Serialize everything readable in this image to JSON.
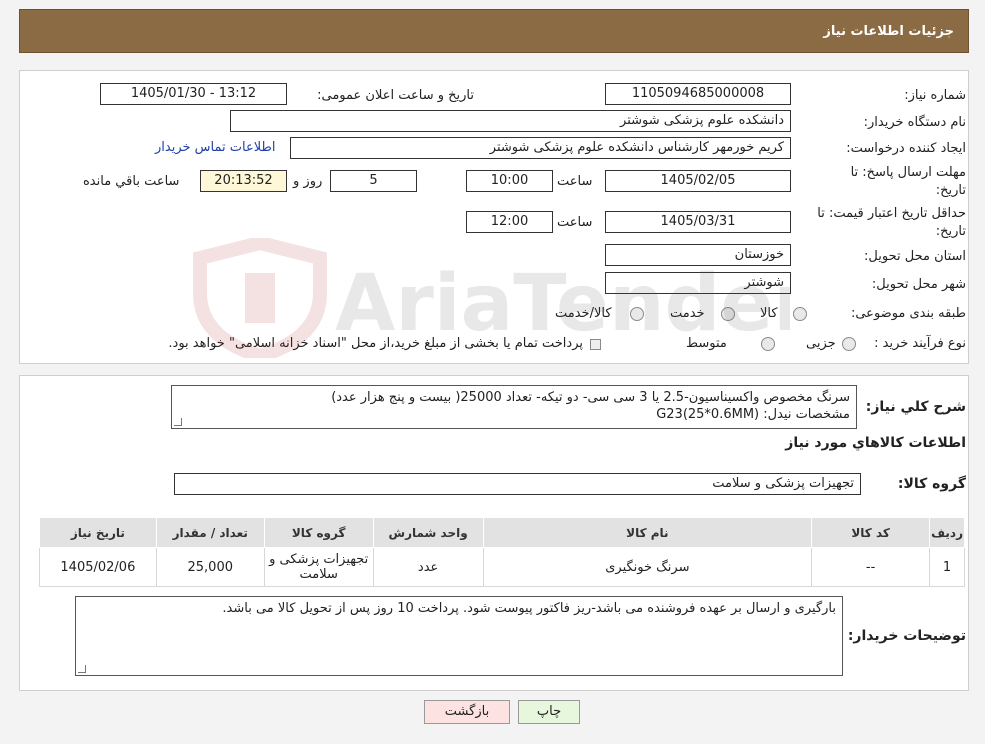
{
  "header": {
    "title": "جزئیات اطلاعات نیاز"
  },
  "form": {
    "need_number_label": "شماره نیاز:",
    "need_number": "1105094685000008",
    "announce_label": "تاریخ و ساعت اعلان عمومی:",
    "announce_value": "1405/01/30 - 13:12",
    "buyer_org_label": "نام دستگاه خریدار:",
    "buyer_org": "دانشکده علوم پزشکی شوشتر",
    "creator_label": "ایجاد کننده درخواست:",
    "creator": "کریم خورمهر کارشناس دانشکده علوم پزشکی شوشتر",
    "contact_link": "اطلاعات تماس خریدار",
    "deadline_label_1": "مهلت ارسال پاسخ: تا",
    "deadline_label_2": "تاریخ:",
    "deadline_date": "1405/02/05",
    "time_label": "ساعت",
    "deadline_time": "10:00",
    "days_value": "5",
    "days_label": "روز و",
    "remaining_value": "20:13:52",
    "remaining_label": "ساعت باقي مانده",
    "validity_label_1": "حداقل تاریخ اعتبار قیمت: تا",
    "validity_label_2": "تاریخ:",
    "validity_date": "1405/03/31",
    "validity_time": "12:00",
    "province_label": "استان محل تحویل:",
    "province": "خوزستان",
    "city_label": "شهر محل تحویل:",
    "city": "شوشتر",
    "category_label": "طبقه بندی موضوعی:",
    "category_options": [
      "کالا",
      "خدمت",
      "کالا/خدمت"
    ],
    "purchase_type_label": "نوع فرآیند خرید :",
    "purchase_options": [
      "جزیی",
      "متوسط"
    ],
    "purchase_note": "پرداخت تمام یا بخشی از مبلغ خرید،از محل \"اسناد خزانه اسلامی\" خواهد بود."
  },
  "watermark": {
    "text": "AriaTender.neT"
  },
  "details": {
    "summary_label": "شرح کلي نياز:",
    "summary_line1": "سرنگ مخصوص واکسیناسیون-2.5 یا 3 سی سی- دو تیکه- تعداد 25000( بیست و پنج هزار عدد)",
    "summary_line2": "مشخصات نیدل: (G23(25*0.6MM",
    "goods_info_title": "اطلاعات کالاهاي مورد نياز",
    "goods_group_label": "گروه کالا:",
    "goods_group": "تجهیزات پزشکی و سلامت",
    "table_headers": [
      "رديف",
      "کد کالا",
      "نام کالا",
      "واحد شمارش",
      "گروه کالا",
      "تعداد / مقدار",
      "تاریخ نیاز"
    ],
    "rows": [
      {
        "idx": "1",
        "code": "--",
        "name": "سرنگ خونگیری",
        "unit": "عدد",
        "group": "تجهیزات پزشکی و سلامت",
        "qty": "25,000",
        "date": "1405/02/06"
      }
    ],
    "buyer_notes_label": "توضیحات خریدار:",
    "buyer_notes": "بارگیری و ارسال بر عهده فروشنده می باشد-ریز فاکتور پیوست شود. پرداخت 10 روز پس از تحویل کالا می باشد."
  },
  "buttons": {
    "print": "چاپ",
    "back": "بازگشت"
  },
  "colors": {
    "header_bg": "#8b6b43",
    "print_bg": "#e6f7dd",
    "back_bg": "#fde2e2",
    "remaining_bg": "#fff8d8"
  }
}
